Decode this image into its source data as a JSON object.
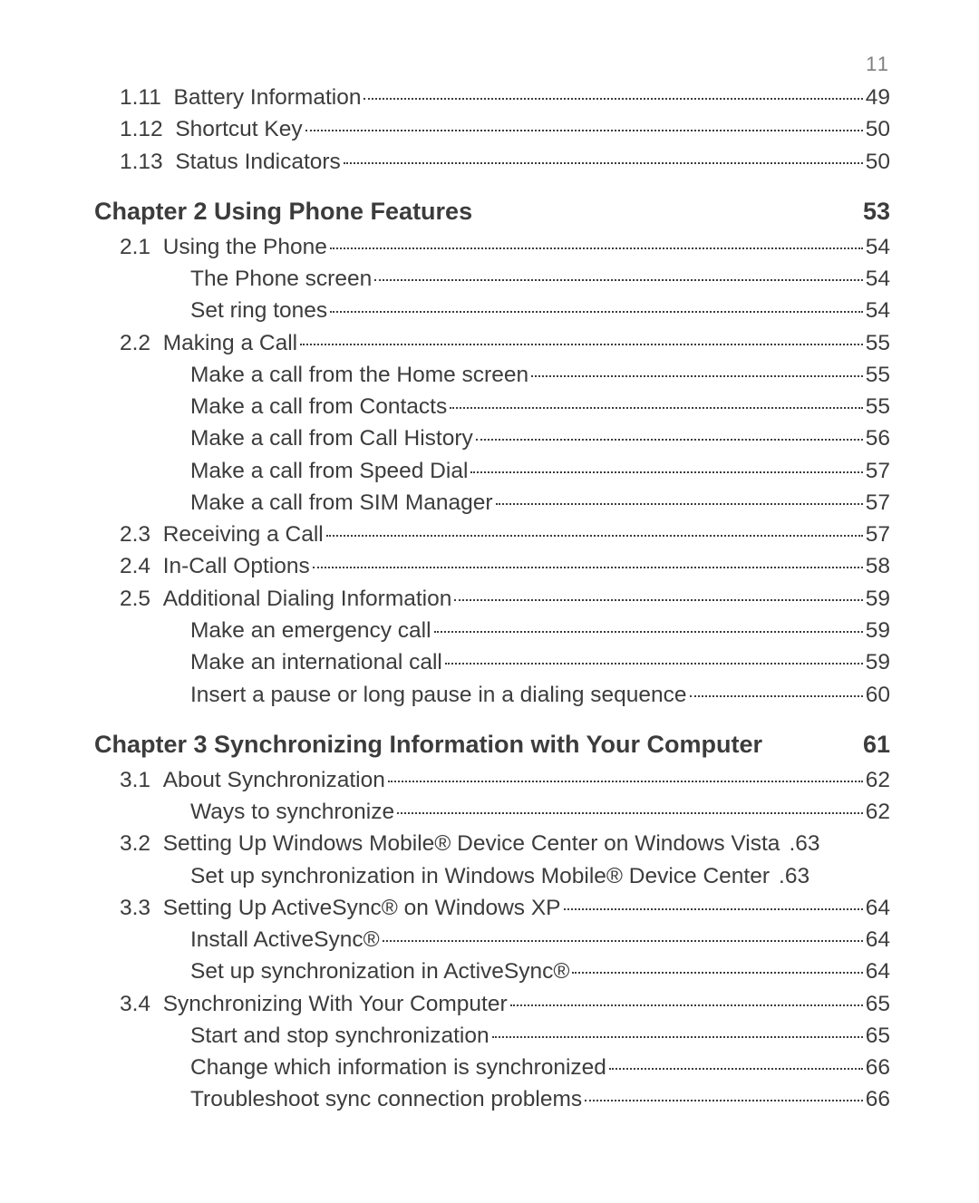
{
  "page_number": "11",
  "items": [
    {
      "type": "section",
      "num": "1.11",
      "title": "Battery Information",
      "page": "49",
      "dots": true
    },
    {
      "type": "section",
      "num": "1.12",
      "title": "Shortcut Key",
      "page": "50",
      "dots": true
    },
    {
      "type": "section",
      "num": "1.13",
      "title": "Status Indicators",
      "page": "50",
      "dots": true
    },
    {
      "type": "chapter",
      "title": "Chapter 2  Using Phone Features",
      "page": "53"
    },
    {
      "type": "section",
      "num": "2.1",
      "title": "Using the Phone",
      "page": "54",
      "dots": true
    },
    {
      "type": "sub",
      "title": "The Phone screen",
      "page": "54",
      "dots": true
    },
    {
      "type": "sub",
      "title": "Set ring tones",
      "page": "54",
      "dots": true
    },
    {
      "type": "section",
      "num": "2.2",
      "title": "Making a Call",
      "page": "55",
      "dots": true
    },
    {
      "type": "sub",
      "title": "Make a call from the Home screen",
      "page": "55",
      "dots": true
    },
    {
      "type": "sub",
      "title": "Make a call from Contacts",
      "page": "55",
      "dots": true
    },
    {
      "type": "sub",
      "title": "Make a call from Call History",
      "page": "56",
      "dots": true
    },
    {
      "type": "sub",
      "title": "Make a call from Speed Dial",
      "page": "57",
      "dots": true
    },
    {
      "type": "sub",
      "title": "Make a call from SIM Manager",
      "page": "57",
      "dots": true
    },
    {
      "type": "section",
      "num": "2.3",
      "title": "Receiving a Call",
      "page": "57",
      "dots": true
    },
    {
      "type": "section",
      "num": "2.4",
      "title": "In-Call Options",
      "page": "58",
      "dots": true
    },
    {
      "type": "section",
      "num": "2.5",
      "title": "Additional Dialing Information",
      "page": "59",
      "dots": true
    },
    {
      "type": "sub",
      "title": "Make an emergency call",
      "page": "59",
      "dots": true
    },
    {
      "type": "sub",
      "title": "Make an international call",
      "page": "59",
      "dots": true
    },
    {
      "type": "sub",
      "title": "Insert a pause or long pause in a dialing sequence",
      "page": "60",
      "dots": true
    },
    {
      "type": "chapter",
      "title": "Chapter 3  Synchronizing Information with Your Computer",
      "page": "61"
    },
    {
      "type": "section",
      "num": "3.1",
      "title": "About Synchronization",
      "page": "62",
      "dots": true
    },
    {
      "type": "sub",
      "title": "Ways to synchronize",
      "page": "62",
      "dots": true
    },
    {
      "type": "section",
      "num": "3.2",
      "title": "Setting Up Windows Mobile® Device Center on Windows Vista",
      "page": "63",
      "dots": false
    },
    {
      "type": "sub",
      "title": "Set up synchronization in Windows Mobile® Device Center",
      "page": "63",
      "dots": false
    },
    {
      "type": "section",
      "num": "3.3",
      "title": "Setting Up ActiveSync® on Windows XP",
      "page": "64",
      "dots": true
    },
    {
      "type": "sub",
      "title": "Install ActiveSync®",
      "page": "64",
      "dots": true
    },
    {
      "type": "sub",
      "title": "Set up synchronization in ActiveSync®",
      "page": "64",
      "dots": true
    },
    {
      "type": "section",
      "num": "3.4",
      "title": "Synchronizing With Your Computer",
      "page": "65",
      "dots": true
    },
    {
      "type": "sub",
      "title": "Start and stop synchronization",
      "page": "65",
      "dots": true
    },
    {
      "type": "sub",
      "title": "Change which information is synchronized",
      "page": "66",
      "dots": true
    },
    {
      "type": "sub",
      "title": "Troubleshoot sync connection problems",
      "page": "66",
      "dots": true
    }
  ]
}
